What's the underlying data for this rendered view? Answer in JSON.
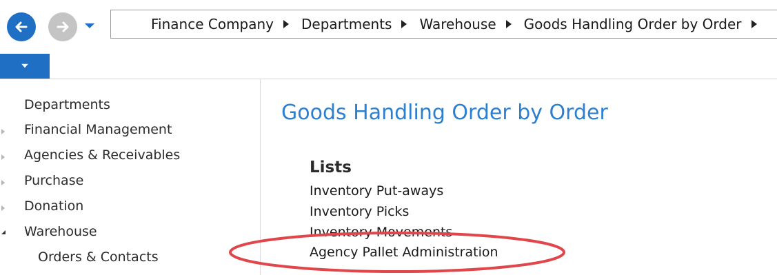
{
  "address_bar": {
    "crumbs": [
      "Finance Company",
      "Departments",
      "Warehouse",
      "Goods Handling Order by Order"
    ]
  },
  "sidebar": {
    "items": [
      {
        "label": "Departments"
      },
      {
        "label": "Financial Management"
      },
      {
        "label": "Agencies & Receivables"
      },
      {
        "label": "Purchase"
      },
      {
        "label": "Donation"
      },
      {
        "label": "Warehouse"
      },
      {
        "label": "Orders & Contacts"
      }
    ]
  },
  "main": {
    "title": "Goods Handling Order by Order",
    "section": {
      "heading": "Lists",
      "links": [
        "Inventory Put-aways",
        "Inventory Picks",
        "Inventory Movements",
        "Agency Pallet Administration"
      ]
    }
  },
  "colors": {
    "accent": "#1f6fc5",
    "title": "#2d7fcf",
    "highlight": "#e0474c"
  },
  "icons": {
    "back": "back-arrow-icon",
    "forward": "forward-arrow-icon",
    "history": "chevron-down-icon",
    "menu": "chevron-down-icon",
    "crumb_separator": "triangle-right-icon"
  }
}
